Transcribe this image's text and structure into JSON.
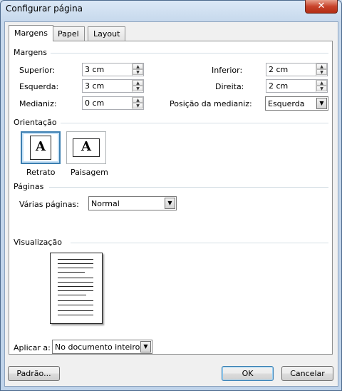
{
  "window": {
    "title": "Configurar página",
    "close_glyph": "✕"
  },
  "tabs": [
    {
      "label": "Margens",
      "active": true
    },
    {
      "label": "Papel",
      "active": false
    },
    {
      "label": "Layout",
      "active": false
    }
  ],
  "margins": {
    "heading": "Margens",
    "superior": {
      "label": "Superior:",
      "value": "3 cm"
    },
    "inferior": {
      "label": "Inferior:",
      "value": "2 cm"
    },
    "esquerda": {
      "label": "Esquerda:",
      "value": "3 cm"
    },
    "direita": {
      "label": "Direita:",
      "value": "2 cm"
    },
    "medianiz": {
      "label": "Medianiz:",
      "value": "0 cm"
    },
    "posicao_medianiz": {
      "label": "Posição da medianiz:",
      "value": "Esquerda"
    }
  },
  "orientation": {
    "heading": "Orientação",
    "retrato": {
      "label": "Retrato",
      "glyph": "A",
      "selected": true
    },
    "paisagem": {
      "label": "Paisagem",
      "glyph": "A",
      "selected": false
    }
  },
  "pages": {
    "heading": "Páginas",
    "multiple_label": "Várias páginas:",
    "multiple_value": "Normal"
  },
  "preview": {
    "heading": "Visualização"
  },
  "apply": {
    "label": "Aplicar a:",
    "value": "No documento inteiro"
  },
  "buttons": {
    "default": "Padrão...",
    "ok": "OK",
    "cancel": "Cancelar"
  },
  "icons": {
    "spin_up": "▲",
    "spin_down": "▼",
    "dropdown": "▼",
    "portrait_icon": "portrait-page-icon",
    "landscape_icon": "landscape-page-icon"
  }
}
